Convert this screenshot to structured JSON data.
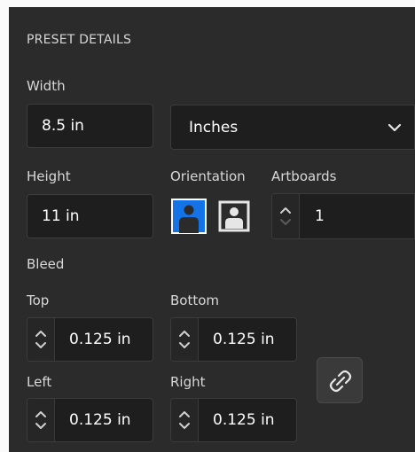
{
  "section_title": "PRESET DETAILS",
  "width": {
    "label": "Width",
    "value": "8.5 in"
  },
  "units": {
    "selected": "Inches"
  },
  "height": {
    "label": "Height",
    "value": "11 in"
  },
  "orientation": {
    "label": "Orientation",
    "selected": "portrait"
  },
  "artboards": {
    "label": "Artboards",
    "value": "1"
  },
  "bleed": {
    "label": "Bleed",
    "top": {
      "label": "Top",
      "value": "0.125 in"
    },
    "bottom": {
      "label": "Bottom",
      "value": "0.125 in"
    },
    "left": {
      "label": "Left",
      "value": "0.125 in"
    },
    "right": {
      "label": "Right",
      "value": "0.125 in"
    },
    "link_icon": "chain-link-icon"
  },
  "colors": {
    "background": "#2b2b2b",
    "field": "#1e1e1e",
    "accent": "#1473e6"
  }
}
